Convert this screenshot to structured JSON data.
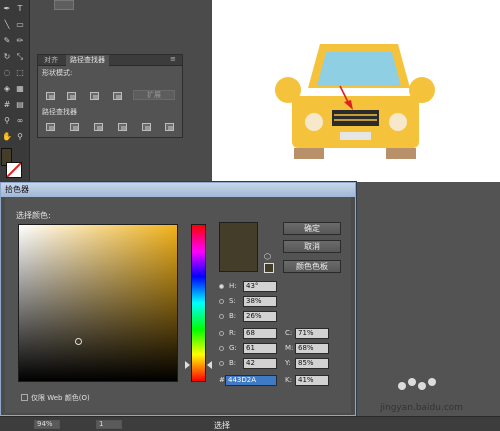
{
  "pathfinder_panel": {
    "tabs": [
      "对齐",
      "路径查找器"
    ],
    "shape_modes_label": "形状模式:",
    "pathfinders_label": "路径查找器",
    "expand_label": "扩展"
  },
  "color_picker": {
    "title": "拾色器",
    "select_color_label": "选择颜色:",
    "ok_label": "确定",
    "cancel_label": "取消",
    "swatches_label": "颜色色板",
    "web_only_label": "仅限 Web 颜色(O)",
    "fields": {
      "H": {
        "label": "H:",
        "value": "43°"
      },
      "S": {
        "label": "S:",
        "value": "38%"
      },
      "B": {
        "label": "B:",
        "value": "26%"
      },
      "R": {
        "label": "R:",
        "value": "68"
      },
      "G": {
        "label": "G:",
        "value": "61"
      },
      "Bl": {
        "label": "B:",
        "value": "42"
      },
      "C": {
        "label": "C:",
        "value": "71%"
      },
      "M": {
        "label": "M:",
        "value": "68%"
      },
      "Y": {
        "label": "Y:",
        "value": "85%"
      },
      "K": {
        "label": "K:",
        "value": "41%"
      },
      "hex": {
        "label": "#",
        "value": "443D2A"
      }
    },
    "current_color": "#443D2A"
  },
  "status_bar": {
    "zoom": "94%",
    "page": "1",
    "mode": "选择"
  },
  "watermark": {
    "text": "jingyan.baidu.com"
  },
  "colors": {
    "car_body": "#F5C33B",
    "car_window": "#8ECFE3",
    "car_grille": "#2B2B2B",
    "car_wheels": "#B8906A",
    "arrow": "#E02020"
  },
  "icons": [
    "pathfinder-unite-icon",
    "pathfinder-minus-front-icon",
    "pathfinder-intersect-icon",
    "pathfinder-exclude-icon",
    "web-safe-cube-icon"
  ]
}
